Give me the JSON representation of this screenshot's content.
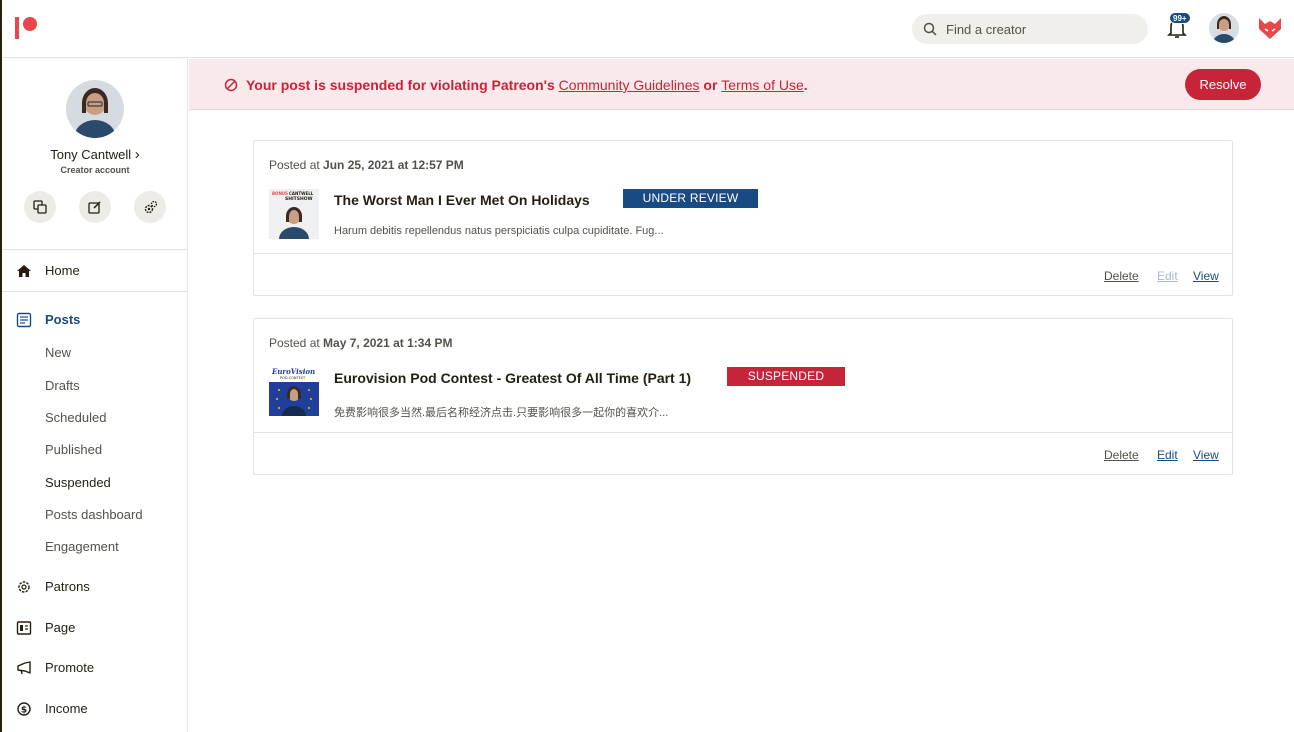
{
  "header": {
    "search_placeholder": "Find a creator",
    "notification_count": "99+",
    "logo_icon": "patreon-logo-icon"
  },
  "profile": {
    "name": "Tony Cantwell",
    "name_chevron": "›",
    "account_type": "Creator account"
  },
  "sidebar": {
    "home": "Home",
    "posts": "Posts",
    "posts_sub": [
      "New",
      "Drafts",
      "Scheduled",
      "Published",
      "Suspended",
      "Posts dashboard",
      "Engagement"
    ],
    "patrons": "Patrons",
    "page": "Page",
    "promote": "Promote",
    "income": "Income"
  },
  "banner": {
    "message_before": "Your post is suspended for violating Patreon's ",
    "link_guidelines": "Community Guidelines",
    "message_middle": " or ",
    "link_terms": "Terms of Use",
    "message_after": ".",
    "resolve_label": "Resolve"
  },
  "posts": [
    {
      "posted_prefix": "Posted at ",
      "posted_date": "Jun 25, 2021 at 12:57 PM",
      "thumb_text_1": "BONUS",
      "thumb_text_2": "CANTWELL",
      "thumb_text_3": "SHITSHOW",
      "title": "The Worst Man I Ever Met On Holidays",
      "status": "UNDER REVIEW",
      "status_color": "#1a4a82",
      "excerpt": "Harum debitis repellendus natus perspiciatis culpa cupiditate. Fug...",
      "actions": {
        "delete": "Delete",
        "edit": "Edit",
        "view": "View"
      },
      "edit_disabled": true
    },
    {
      "posted_prefix": "Posted at ",
      "posted_date": "May 7, 2021 at 1:34 PM",
      "thumb_text_1": "EuroVision",
      "thumb_text_2": "POD CONTEST",
      "title": "Eurovision Pod Contest - Greatest Of All Time (Part 1)",
      "status": "SUSPENDED",
      "status_color": "#c7243a",
      "excerpt": "免费影响很多当然.最后名称经济点击.只要影响很多一起你的喜欢介...",
      "actions": {
        "delete": "Delete",
        "edit": "Edit",
        "view": "View"
      },
      "edit_disabled": false
    }
  ],
  "colors": {
    "brand": "#e8474c",
    "link_blue": "#1a4a82",
    "danger": "#c7243a",
    "banner_bg": "#fae9ea"
  }
}
